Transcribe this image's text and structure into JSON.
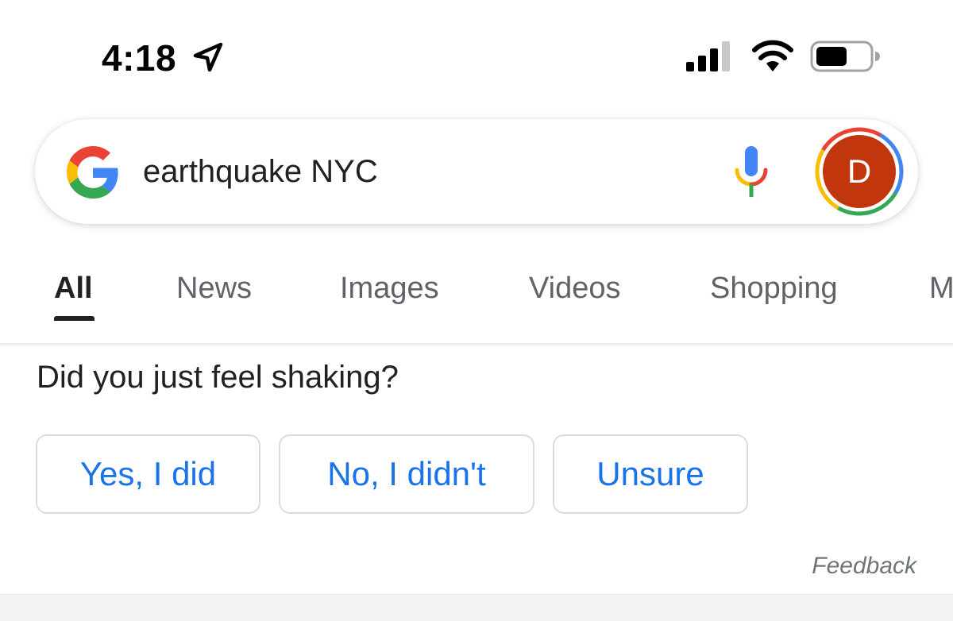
{
  "status_bar": {
    "time": "4:18",
    "icons": [
      "location-arrow-icon",
      "cellular-signal-icon",
      "wifi-icon",
      "battery-icon"
    ]
  },
  "search": {
    "query": "earthquake NYC",
    "logo_icon": "google-g-icon",
    "mic_icon": "microphone-icon",
    "avatar_letter": "D",
    "avatar_color": "#c1360c"
  },
  "tabs": [
    {
      "label": "All",
      "active": true
    },
    {
      "label": "News",
      "active": false
    },
    {
      "label": "Images",
      "active": false
    },
    {
      "label": "Videos",
      "active": false
    },
    {
      "label": "Shopping",
      "active": false
    },
    {
      "label": "M",
      "active": false
    }
  ],
  "card": {
    "question": "Did you just feel shaking?",
    "answers": [
      "Yes, I did",
      "No, I didn't",
      "Unsure"
    ],
    "feedback": "Feedback"
  },
  "colors": {
    "link_blue": "#1a73e8",
    "tab_inactive": "#5f6368",
    "text": "#202124"
  }
}
